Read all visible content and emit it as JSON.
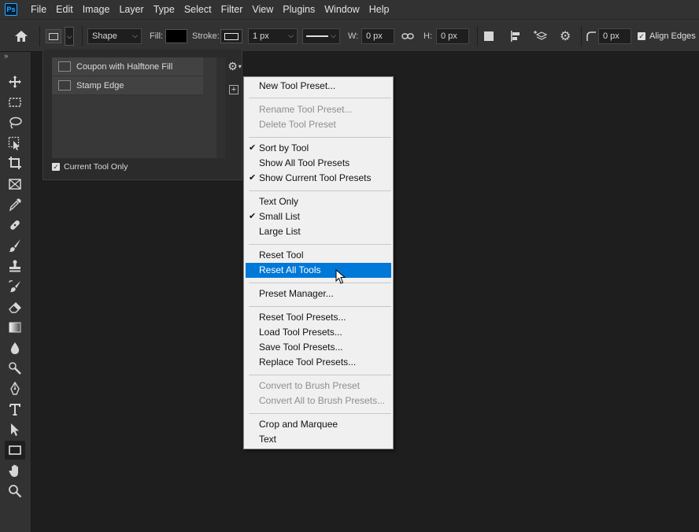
{
  "menubar": {
    "logo": "Ps",
    "items": [
      "File",
      "Edit",
      "Image",
      "Layer",
      "Type",
      "Select",
      "Filter",
      "View",
      "Plugins",
      "Window",
      "Help"
    ]
  },
  "options": {
    "shape_mode": "Shape",
    "fill_label": "Fill:",
    "stroke_label": "Stroke:",
    "stroke_width": "1 px",
    "w_label": "W:",
    "w_value": "0 px",
    "h_label": "H:",
    "h_value": "0 px",
    "radius_value": "0 px",
    "align_edges": "Align Edges"
  },
  "preset_panel": {
    "items": [
      {
        "label": "Coupon with Halftone Fill"
      },
      {
        "label": "Stamp Edge"
      }
    ],
    "current_tool_only": "Current Tool Only"
  },
  "context_menu": {
    "items": [
      {
        "label": "New Tool Preset...",
        "disabled": false,
        "checked": false
      },
      {
        "label": "Rename Tool Preset...",
        "disabled": true,
        "checked": false
      },
      {
        "label": "Delete Tool Preset",
        "disabled": true,
        "checked": false
      },
      {
        "label": "Sort by Tool",
        "disabled": false,
        "checked": true
      },
      {
        "label": "Show All Tool Presets",
        "disabled": false,
        "checked": false
      },
      {
        "label": "Show Current Tool Presets",
        "disabled": false,
        "checked": true
      },
      {
        "label": "Text Only",
        "disabled": false,
        "checked": false
      },
      {
        "label": "Small List",
        "disabled": false,
        "checked": true
      },
      {
        "label": "Large List",
        "disabled": false,
        "checked": false
      },
      {
        "label": "Reset Tool",
        "disabled": false,
        "checked": false
      },
      {
        "label": "Reset All Tools",
        "disabled": false,
        "checked": false,
        "highlighted": true
      },
      {
        "label": "Preset Manager...",
        "disabled": false,
        "checked": false
      },
      {
        "label": "Reset Tool Presets...",
        "disabled": false,
        "checked": false
      },
      {
        "label": "Load Tool Presets...",
        "disabled": false,
        "checked": false
      },
      {
        "label": "Save Tool Presets...",
        "disabled": false,
        "checked": false
      },
      {
        "label": "Replace Tool Presets...",
        "disabled": false,
        "checked": false
      },
      {
        "label": "Convert to Brush Preset",
        "disabled": true,
        "checked": false
      },
      {
        "label": "Convert All to Brush Presets...",
        "disabled": true,
        "checked": false
      },
      {
        "label": "Crop and Marquee",
        "disabled": false,
        "checked": false
      },
      {
        "label": "Text",
        "disabled": false,
        "checked": false
      }
    ],
    "check_glyph": "✔"
  },
  "toolbar": {
    "tools": [
      "move-tool-icon",
      "rect-marquee-icon",
      "lasso-icon",
      "object-select-icon",
      "crop-icon",
      "frame-icon",
      "eyedropper-icon",
      "healing-brush-icon",
      "brush-icon",
      "clone-stamp-icon",
      "history-brush-icon",
      "eraser-icon",
      "gradient-icon",
      "blur-icon",
      "dodge-icon",
      "pen-icon",
      "type-icon",
      "path-select-icon",
      "rectangle-tool-icon",
      "hand-icon",
      "zoom-icon"
    ],
    "active_tool": "rectangle-tool-icon"
  }
}
